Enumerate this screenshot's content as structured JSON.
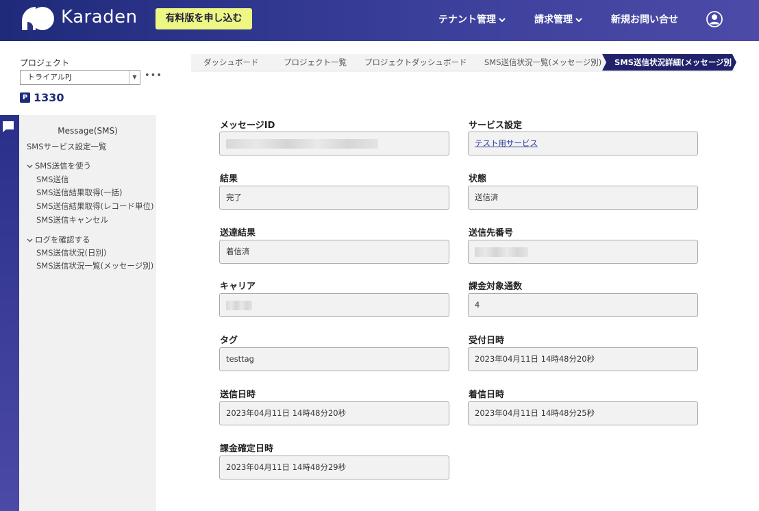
{
  "header": {
    "brand": "Karaden",
    "trial_button": "有料版を申し込む",
    "nav": [
      {
        "label": "テナント管理",
        "chevron": "⌄"
      },
      {
        "label": "請求管理",
        "chevron": "⌄"
      },
      {
        "label": "新規お問い合せ"
      }
    ],
    "colors": {
      "header_start": "#1f2a7a",
      "header_end": "#4d4aa8",
      "trial_bg": "#eef784"
    }
  },
  "project": {
    "label": "プロジェクト",
    "selected": "トライアルPJ",
    "more": "•••",
    "points_icon": "P",
    "points": "1330"
  },
  "sidebar": {
    "title": "Message(SMS)",
    "top_link": "SMSサービス設定一覧",
    "groups": [
      {
        "label": "SMS送信を使う",
        "items": [
          "SMS送信",
          "SMS送信結果取得(一括)",
          "SMS送信結果取得(レコード単位)",
          "SMS送信キャンセル"
        ]
      },
      {
        "label": "ログを確認する",
        "items": [
          "SMS送信状況(日別)",
          "SMS送信状況一覧(メッセージ別)"
        ]
      }
    ]
  },
  "breadcrumb": [
    "ダッシュボード",
    "プロジェクト一覧",
    "プロジェクトダッシュボード",
    "SMS送信状況一覧(メッセージ別)",
    "SMS送信状況詳細(メッセージ別)"
  ],
  "fields": {
    "message_id": {
      "label": "メッセージID",
      "value": ""
    },
    "service": {
      "label": "サービス設定",
      "value": "テスト用サービス"
    },
    "result": {
      "label": "結果",
      "value": "完了"
    },
    "status": {
      "label": "状態",
      "value": "送信済"
    },
    "delivery_result": {
      "label": "送達結果",
      "value": "着信済"
    },
    "recipient": {
      "label": "送信先番号",
      "value": ""
    },
    "carrier": {
      "label": "キャリア",
      "value": ""
    },
    "billing_count": {
      "label": "課金対象通数",
      "value": "4"
    },
    "tag": {
      "label": "タグ",
      "value": "testtag"
    },
    "received_at": {
      "label": "受付日時",
      "value": "2023年04月11日 14時48分20秒"
    },
    "sent_at": {
      "label": "送信日時",
      "value": "2023年04月11日 14時48分20秒"
    },
    "delivered_at": {
      "label": "着信日時",
      "value": "2023年04月11日 14時48分25秒"
    },
    "billing_confirmed_at": {
      "label": "課金確定日時",
      "value": "2023年04月11日 14時48分29秒"
    }
  }
}
